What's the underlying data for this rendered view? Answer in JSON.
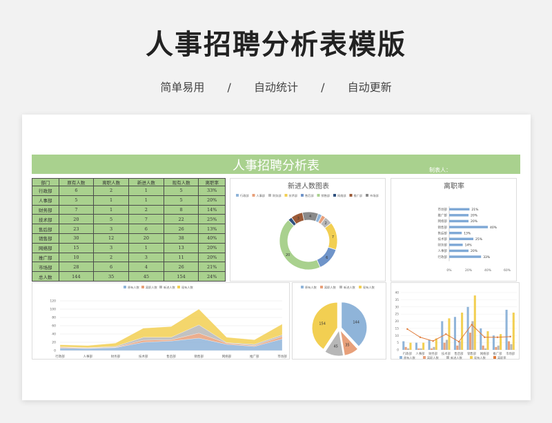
{
  "hero": {
    "title": "人事招聘分析表模版",
    "sub1": "简单易用",
    "sep1": "/",
    "sub2": "自动统计",
    "sep2": "/",
    "sub3": "自动更新"
  },
  "sheet": {
    "title": "人事招聘分析表",
    "maker": "制表人："
  },
  "table": {
    "headers": [
      "部门",
      "原有人数",
      "离职人数",
      "新进人数",
      "现有人数",
      "离职率"
    ],
    "rows": [
      [
        "行政部",
        "6",
        "2",
        "1",
        "5",
        "33%"
      ],
      [
        "人事部",
        "5",
        "1",
        "1",
        "5",
        "20%"
      ],
      [
        "财务部",
        "7",
        "1",
        "2",
        "8",
        "14%"
      ],
      [
        "技术部",
        "20",
        "5",
        "7",
        "22",
        "25%"
      ],
      [
        "售后部",
        "23",
        "3",
        "6",
        "26",
        "13%"
      ],
      [
        "销售部",
        "30",
        "12",
        "20",
        "38",
        "40%"
      ],
      [
        "网络部",
        "15",
        "3",
        "1",
        "13",
        "20%"
      ],
      [
        "推广部",
        "10",
        "2",
        "3",
        "11",
        "20%"
      ],
      [
        "市场部",
        "28",
        "6",
        "4",
        "26",
        "21%"
      ],
      [
        "总人数",
        "144",
        "35",
        "45",
        "154",
        "24%"
      ]
    ]
  },
  "colors": {
    "blue": "#8fb4d9",
    "orange": "#e8a07a",
    "gray": "#b7b7b7",
    "yellow": "#f2cf52",
    "green": "#a9d18e",
    "navy": "#4a6fb5",
    "bar": "#7fa9d6",
    "line": "#e07b39"
  },
  "chart_data": [
    {
      "type": "pie",
      "title": "新进人数图表",
      "legend": [
        "行政部",
        "人事部",
        "财务部",
        "技术部",
        "售后部",
        "销售部",
        "网络部",
        "推广部",
        "市场部"
      ],
      "categories": [
        "行政部",
        "人事部",
        "财务部",
        "技术部",
        "售后部",
        "销售部",
        "网络部",
        "推广部",
        "市场部"
      ],
      "values": [
        1,
        1,
        2,
        7,
        6,
        20,
        1,
        3,
        4
      ],
      "labels": [
        "",
        "",
        "2",
        "7",
        "6",
        "20",
        "",
        "3",
        "4"
      ]
    },
    {
      "type": "bar",
      "title": "离职率",
      "categories": [
        "行政部",
        "人事部",
        "财务部",
        "技术部",
        "售后部",
        "销售部",
        "网络部",
        "推广部",
        "市场部"
      ],
      "values": [
        33,
        20,
        14,
        25,
        13,
        40,
        20,
        20,
        21
      ],
      "labels": [
        "33%",
        "20%",
        "14%",
        "25%",
        "13%",
        "40%",
        "20%",
        "20%",
        "21%"
      ],
      "ticks": [
        "0%",
        "20%",
        "40%",
        "60%"
      ],
      "xlim": [
        0,
        60
      ]
    },
    {
      "type": "area",
      "legend": [
        "原有人数",
        "离职人数",
        "新进人数",
        "现有人数"
      ],
      "categories": [
        "行政部",
        "人事部",
        "财务部",
        "技术部",
        "售后部",
        "销售部",
        "网络部",
        "推广部",
        "市场部"
      ],
      "series": [
        {
          "name": "原有人数",
          "values": [
            6,
            5,
            7,
            20,
            23,
            30,
            15,
            10,
            28
          ]
        },
        {
          "name": "离职人数",
          "values": [
            2,
            1,
            1,
            5,
            3,
            12,
            3,
            2,
            6
          ]
        },
        {
          "name": "新进人数",
          "values": [
            1,
            1,
            2,
            7,
            6,
            20,
            1,
            3,
            4
          ]
        },
        {
          "name": "现有人数",
          "values": [
            5,
            5,
            8,
            22,
            26,
            38,
            13,
            11,
            26
          ]
        }
      ],
      "yticks": [
        "0",
        "20",
        "40",
        "60",
        "80",
        "100",
        "120"
      ],
      "ylim": [
        0,
        120
      ]
    },
    {
      "type": "pie",
      "legend": [
        "原有人数",
        "离职人数",
        "新进人数",
        "现有人数"
      ],
      "categories": [
        "原有人数",
        "离职人数",
        "新进人数",
        "现有人数"
      ],
      "values": [
        144,
        35,
        45,
        154
      ],
      "labels": [
        "144",
        "35",
        "45",
        "154"
      ]
    },
    {
      "type": "bar",
      "legend": [
        "原有人数",
        "离职人数",
        "新进人数",
        "现有人数",
        "离职率"
      ],
      "categories": [
        "行政部",
        "人事部",
        "财务部",
        "技术部",
        "售后部",
        "销售部",
        "网络部",
        "推广部",
        "市场部"
      ],
      "series": [
        {
          "name": "原有人数",
          "values": [
            6,
            5,
            7,
            20,
            23,
            30,
            15,
            10,
            28
          ]
        },
        {
          "name": "离职人数",
          "values": [
            2,
            1,
            1,
            5,
            3,
            12,
            3,
            2,
            6
          ]
        },
        {
          "name": "新进人数",
          "values": [
            1,
            1,
            2,
            7,
            6,
            20,
            1,
            3,
            4
          ]
        },
        {
          "name": "现有人数",
          "values": [
            5,
            5,
            8,
            22,
            26,
            38,
            13,
            11,
            26
          ]
        }
      ],
      "line": {
        "name": "离职率",
        "values": [
          33,
          20,
          14,
          25,
          13,
          40,
          20,
          20,
          21
        ]
      },
      "yticks": [
        "0",
        "5",
        "10",
        "15",
        "20",
        "25",
        "30",
        "35",
        "40"
      ],
      "ylim": [
        0,
        40
      ]
    }
  ]
}
